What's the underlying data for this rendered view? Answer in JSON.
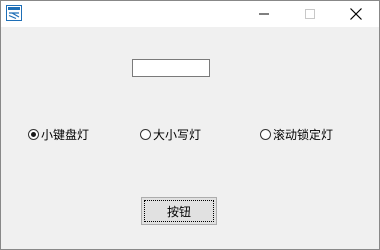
{
  "window": {
    "title": "",
    "app_icon": "app-icon",
    "controls": {
      "minimize_icon": "minimize-icon",
      "maximize_icon": "maximize-icon",
      "close_icon": "close-icon"
    }
  },
  "form": {
    "textbox_value": "",
    "radios": [
      {
        "label": "小键盘灯",
        "checked": true
      },
      {
        "label": "大小写灯",
        "checked": false
      },
      {
        "label": "滚动锁定灯",
        "checked": false
      }
    ],
    "button_label": "按钮"
  }
}
